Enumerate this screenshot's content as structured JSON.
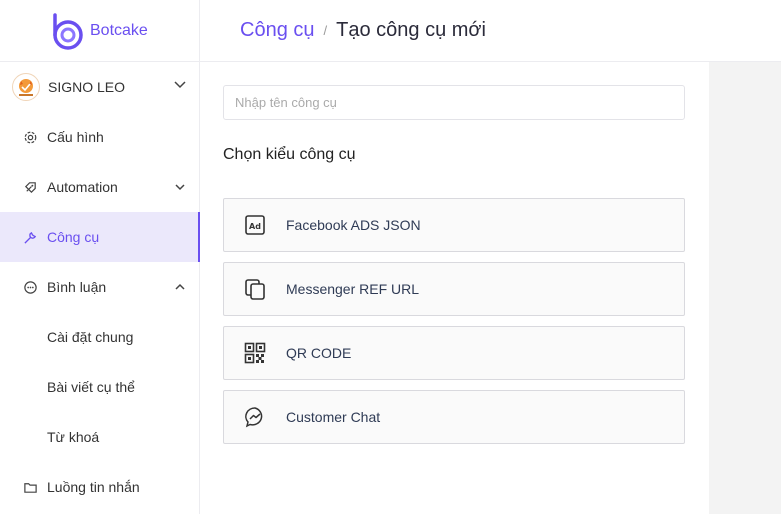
{
  "brand": {
    "name": "Botcake",
    "accent": "#6a4ff0"
  },
  "account": {
    "name": "SIGNO LEO",
    "avatar_icon": "shop-avatar-icon",
    "caret_icon": "chevron-down-icon"
  },
  "sidebar": {
    "items": [
      {
        "label": "Cấu hình",
        "icon": "gear-icon"
      },
      {
        "label": "Automation",
        "icon": "rocket-icon",
        "expandable": true,
        "expanded": false
      },
      {
        "label": "Công cụ",
        "icon": "wrench-icon",
        "active": true
      },
      {
        "label": "Bình luận",
        "icon": "comment-icon",
        "expandable": true,
        "expanded": true
      },
      {
        "label": "Luồng tin nhắn",
        "icon": "folder-icon"
      }
    ],
    "sub_items": [
      {
        "label": "Cài đặt chung"
      },
      {
        "label": "Bài viết cụ thể"
      },
      {
        "label": "Từ khoá"
      }
    ]
  },
  "header": {
    "breadcrumb_root": "Công cụ",
    "breadcrumb_sep": "/",
    "breadcrumb_current": "Tạo công cụ mới"
  },
  "form": {
    "name_placeholder": "Nhập tên công cụ",
    "name_value": "",
    "section_title": "Chọn kiểu công cụ"
  },
  "tool_types": [
    {
      "label": "Facebook ADS JSON",
      "icon": "ad-icon"
    },
    {
      "label": "Messenger REF URL",
      "icon": "copy-icon"
    },
    {
      "label": "QR CODE",
      "icon": "qr-code-icon"
    },
    {
      "label": "Customer Chat",
      "icon": "messenger-icon"
    }
  ]
}
